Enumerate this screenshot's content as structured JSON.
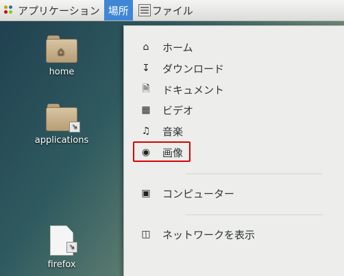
{
  "panel": {
    "applications_label": "アプリケーション",
    "places_label": "場所",
    "file_label": "ファイル"
  },
  "desktop": {
    "icons": [
      {
        "label": "home",
        "icon": "home-folder-icon"
      },
      {
        "label": "applications",
        "icon": "folder-link-icon"
      },
      {
        "label": "firefox",
        "icon": "document-link-icon"
      }
    ]
  },
  "menu": {
    "items": [
      {
        "label": "ホーム",
        "icon": "home-icon"
      },
      {
        "label": "ダウンロード",
        "icon": "download-icon"
      },
      {
        "label": "ドキュメント",
        "icon": "document-icon"
      },
      {
        "label": "ビデオ",
        "icon": "film-icon"
      },
      {
        "label": "音楽",
        "icon": "music-icon"
      },
      {
        "label": "画像",
        "icon": "camera-icon"
      },
      {
        "label": "コンピューター",
        "icon": "computer-icon"
      },
      {
        "label": "ネットワークを表示",
        "icon": "network-icon"
      }
    ]
  },
  "colors": {
    "active_menu": "#3f87d6",
    "highlight_box": "#d40000"
  }
}
